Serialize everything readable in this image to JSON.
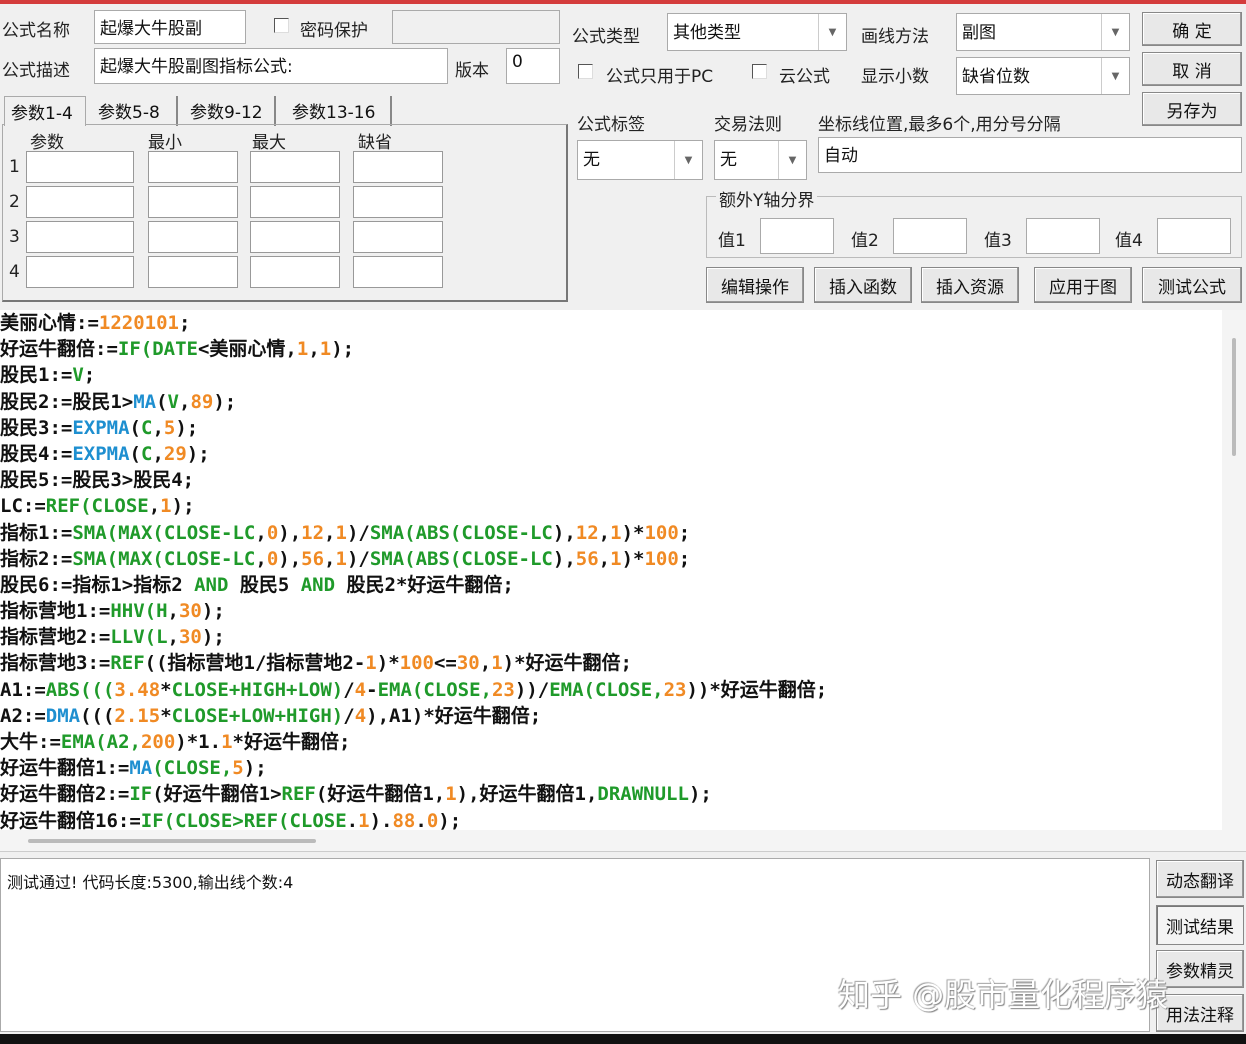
{
  "form": {
    "name_label": "公式名称",
    "name_value": "起爆大牛股副",
    "password_label": "密码保护",
    "password_value": "",
    "desc_label": "公式描述",
    "desc_value": "起爆大牛股副图指标公式:",
    "version_label": "版本",
    "version_value": "0",
    "type_label": "公式类型",
    "type_value": "其他类型",
    "draw_label": "画线方法",
    "draw_value": "副图",
    "pc_only_label": "公式只用于PC",
    "cloud_label": "云公式",
    "decimals_label": "显示小数",
    "decimals_value": "缺省位数",
    "tag_label": "公式标签",
    "tag_value": "无",
    "rule_label": "交易法则",
    "rule_value": "无",
    "axis_label": "坐标线位置,最多6个,用分号分隔",
    "axis_value": "自动",
    "yaxis_group": "额外Y轴分界",
    "y_values": [
      {
        "label": "值1",
        "value": ""
      },
      {
        "label": "值2",
        "value": ""
      },
      {
        "label": "值3",
        "value": ""
      },
      {
        "label": "值4",
        "value": ""
      }
    ]
  },
  "buttons": {
    "ok": "确  定",
    "cancel": "取  消",
    "save_as": "另存为",
    "edit": "编辑操作",
    "insert_func": "插入函数",
    "insert_res": "插入资源",
    "apply": "应用于图",
    "test": "测试公式",
    "side": [
      "动态翻译",
      "测试结果",
      "参数精灵",
      "用法注释"
    ]
  },
  "params": {
    "tabs": [
      "参数1-4",
      "参数5-8",
      "参数9-12",
      "参数13-16"
    ],
    "headers": [
      "参数",
      "最小",
      "最大",
      "缺省"
    ],
    "rows": [
      "1",
      "2",
      "3",
      "4"
    ]
  },
  "code_lines": [
    [
      [
        "美丽心情:=",
        "k"
      ],
      [
        "1220101",
        "o"
      ],
      [
        ";",
        "k"
      ]
    ],
    [
      [
        "好运牛翻倍:=",
        "k"
      ],
      [
        "IF(DATE",
        "g"
      ],
      [
        "<美丽心情,",
        "k"
      ],
      [
        "1",
        "o"
      ],
      [
        ",",
        "k"
      ],
      [
        "1",
        "o"
      ],
      [
        ");",
        "k"
      ]
    ],
    [
      [
        "股民1:=",
        "k"
      ],
      [
        "V",
        "g"
      ],
      [
        ";",
        "k"
      ]
    ],
    [
      [
        "股民2:=股民1>",
        "k"
      ],
      [
        "MA",
        "b"
      ],
      [
        "(",
        "k"
      ],
      [
        "V",
        "g"
      ],
      [
        ",",
        "k"
      ],
      [
        "89",
        "o"
      ],
      [
        ");",
        "k"
      ]
    ],
    [
      [
        "股民3:=",
        "k"
      ],
      [
        "EXPMA",
        "b"
      ],
      [
        "(",
        "k"
      ],
      [
        "C",
        "g"
      ],
      [
        ",",
        "k"
      ],
      [
        "5",
        "o"
      ],
      [
        ");",
        "k"
      ]
    ],
    [
      [
        "股民4:=",
        "k"
      ],
      [
        "EXPMA",
        "b"
      ],
      [
        "(",
        "k"
      ],
      [
        "C",
        "g"
      ],
      [
        ",",
        "k"
      ],
      [
        "29",
        "o"
      ],
      [
        ");",
        "k"
      ]
    ],
    [
      [
        "股民5:=股民3>股民4;",
        "k"
      ]
    ],
    [
      [
        "LC:=",
        "k"
      ],
      [
        "REF(CLOSE",
        "g"
      ],
      [
        ",",
        "k"
      ],
      [
        "1",
        "o"
      ],
      [
        ");",
        "k"
      ]
    ],
    [
      [
        "指标1:=",
        "k"
      ],
      [
        "SMA(MAX(CLOSE-LC",
        "g"
      ],
      [
        ",",
        "k"
      ],
      [
        "0",
        "o"
      ],
      [
        "),",
        "k"
      ],
      [
        "12",
        "o"
      ],
      [
        ",",
        "k"
      ],
      [
        "1",
        "o"
      ],
      [
        ")/",
        "k"
      ],
      [
        "SMA(ABS(CLOSE-LC",
        "g"
      ],
      [
        "),",
        "k"
      ],
      [
        "12",
        "o"
      ],
      [
        ",",
        "k"
      ],
      [
        "1",
        "o"
      ],
      [
        ")*",
        "k"
      ],
      [
        "100",
        "o"
      ],
      [
        ";",
        "k"
      ]
    ],
    [
      [
        "指标2:=",
        "k"
      ],
      [
        "SMA(MAX(CLOSE-LC",
        "g"
      ],
      [
        ",",
        "k"
      ],
      [
        "0",
        "o"
      ],
      [
        "),",
        "k"
      ],
      [
        "56",
        "o"
      ],
      [
        ",",
        "k"
      ],
      [
        "1",
        "o"
      ],
      [
        ")/",
        "k"
      ],
      [
        "SMA(ABS(CLOSE-LC",
        "g"
      ],
      [
        "),",
        "k"
      ],
      [
        "56",
        "o"
      ],
      [
        ",",
        "k"
      ],
      [
        "1",
        "o"
      ],
      [
        ")*",
        "k"
      ],
      [
        "100",
        "o"
      ],
      [
        ";",
        "k"
      ]
    ],
    [
      [
        "股民6:=指标1>指标2 ",
        "k"
      ],
      [
        "AND",
        "g"
      ],
      [
        " 股民5 ",
        "k"
      ],
      [
        "AND",
        "g"
      ],
      [
        " 股民2*好运牛翻倍;",
        "k"
      ]
    ],
    [
      [
        "指标营地1:=",
        "k"
      ],
      [
        "HHV(H",
        "g"
      ],
      [
        ",",
        "k"
      ],
      [
        "30",
        "o"
      ],
      [
        ");",
        "k"
      ]
    ],
    [
      [
        "指标营地2:=",
        "k"
      ],
      [
        "LLV(L",
        "g"
      ],
      [
        ",",
        "k"
      ],
      [
        "30",
        "o"
      ],
      [
        ");",
        "k"
      ]
    ],
    [
      [
        "指标营地3:=",
        "k"
      ],
      [
        "REF",
        "g"
      ],
      [
        "((指标营地1/指标营地2-",
        "k"
      ],
      [
        "1",
        "o"
      ],
      [
        ")*",
        "k"
      ],
      [
        "100",
        "o"
      ],
      [
        "<=",
        "k"
      ],
      [
        "30",
        "o"
      ],
      [
        ",",
        "k"
      ],
      [
        "1",
        "o"
      ],
      [
        ")*好运牛翻倍;",
        "k"
      ]
    ],
    [
      [
        "A1:=",
        "k"
      ],
      [
        "ABS(((",
        "g"
      ],
      [
        "3.48",
        "o"
      ],
      [
        "*",
        "k"
      ],
      [
        "CLOSE+HIGH+LOW)",
        "g"
      ],
      [
        "/",
        "k"
      ],
      [
        "4",
        "o"
      ],
      [
        "-",
        "k"
      ],
      [
        "EMA(CLOSE,",
        "g"
      ],
      [
        "23",
        "o"
      ],
      [
        "))/",
        "k"
      ],
      [
        "EMA(CLOSE,",
        "g"
      ],
      [
        "23",
        "o"
      ],
      [
        "))*好运牛翻倍;",
        "k"
      ]
    ],
    [
      [
        "A2:=",
        "k"
      ],
      [
        "DMA",
        "b"
      ],
      [
        "(((",
        "k"
      ],
      [
        "2.15",
        "o"
      ],
      [
        "*",
        "k"
      ],
      [
        "CLOSE+LOW+HIGH)",
        "g"
      ],
      [
        "/",
        "k"
      ],
      [
        "4",
        "o"
      ],
      [
        "),A1)*好运牛翻倍;",
        "k"
      ]
    ],
    [
      [
        "大牛:=",
        "k"
      ],
      [
        "EMA(A2,",
        "g"
      ],
      [
        "200",
        "o"
      ],
      [
        ")*1.",
        "k"
      ],
      [
        "1",
        "o"
      ],
      [
        "*好运牛翻倍;",
        "k"
      ]
    ],
    [
      [
        "好运牛翻倍1:=",
        "k"
      ],
      [
        "MA",
        "b"
      ],
      [
        "(CLOSE,",
        "g"
      ],
      [
        "5",
        "o"
      ],
      [
        ");",
        "k"
      ]
    ],
    [
      [
        "好运牛翻倍2:=",
        "k"
      ],
      [
        "IF",
        "g"
      ],
      [
        "(好运牛翻倍1>",
        "k"
      ],
      [
        "REF",
        "g"
      ],
      [
        "(好运牛翻倍1,",
        "k"
      ],
      [
        "1",
        "o"
      ],
      [
        "),好运牛翻倍1,",
        "k"
      ],
      [
        "DRAWNULL",
        "g"
      ],
      [
        ");",
        "k"
      ]
    ],
    [
      [
        "好运牛翻倍16:=",
        "k"
      ],
      [
        "IF(CLOSE>REF(CLOSE",
        "g"
      ],
      [
        ".",
        "k"
      ],
      [
        "1",
        "o"
      ],
      [
        ").",
        "k"
      ],
      [
        "88",
        "o"
      ],
      [
        ".",
        "k"
      ],
      [
        "0",
        "o"
      ],
      [
        ");",
        "k"
      ]
    ]
  ],
  "status_text": "测试通过! 代码长度:5300,输出线个数:4",
  "watermark": "知乎 @股市量化程序猿"
}
